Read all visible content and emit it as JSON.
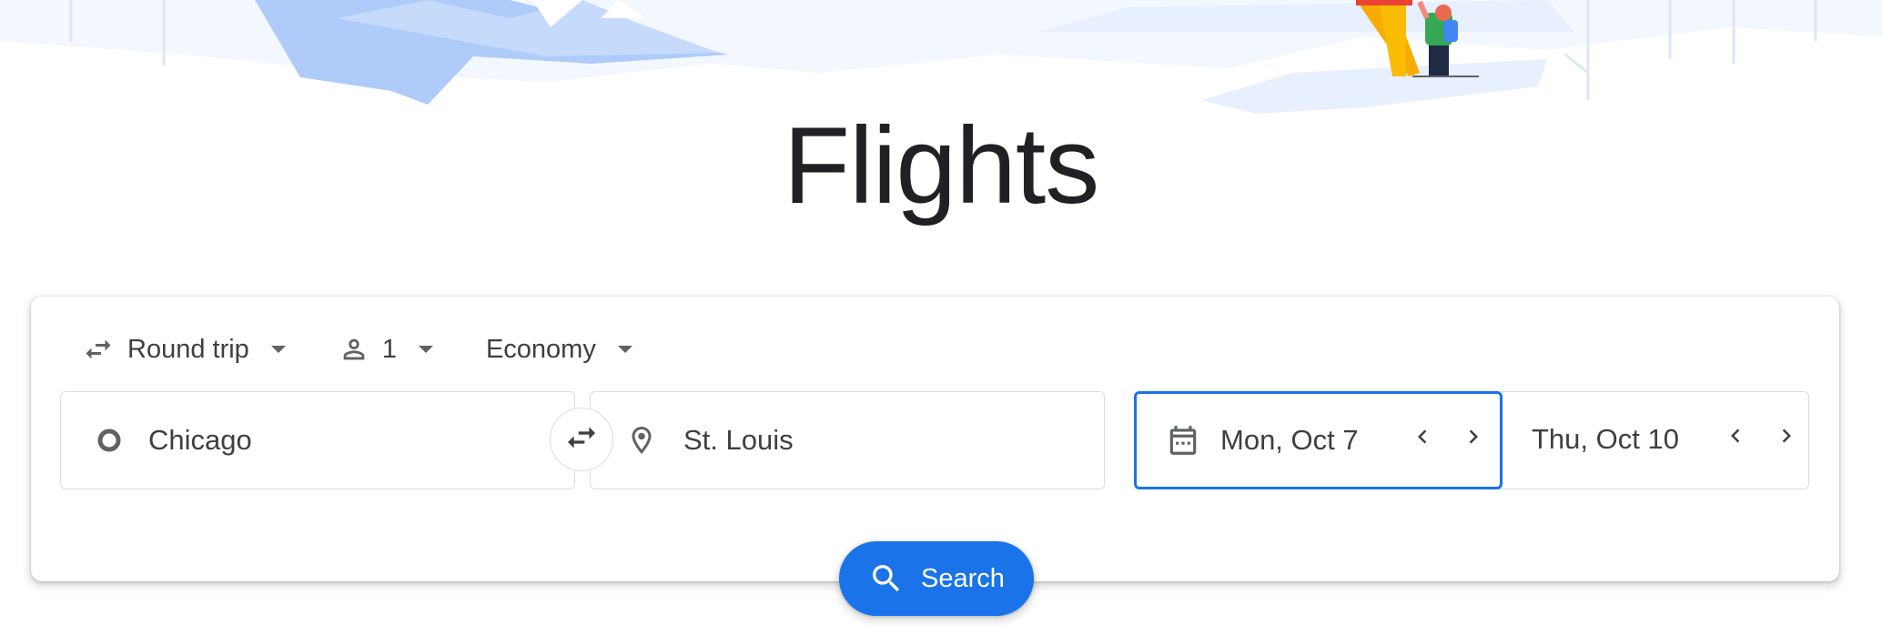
{
  "page": {
    "title": "Flights"
  },
  "options": {
    "trip_type": "Round trip",
    "passengers": "1",
    "cabin_class": "Economy"
  },
  "search": {
    "origin": "Chicago",
    "destination": "St. Louis",
    "departure_date": "Mon, Oct 7",
    "return_date": "Thu, Oct 10",
    "button_label": "Search"
  },
  "icons": {
    "trip_type": "swap-horizontal-icon",
    "passengers": "person-icon",
    "dropdown": "caret-down-icon",
    "origin": "circle-icon",
    "swap": "swap-arrows-icon",
    "destination": "location-pin-icon",
    "calendar": "calendar-icon",
    "previous": "chevron-left-icon",
    "next": "chevron-right-icon",
    "search": "search-icon"
  },
  "colors": {
    "accent": "#1a73e8",
    "illustration_light": "#e8f0fe",
    "illustration_mid": "#aecbfa",
    "text": "#3c4043",
    "title": "#202124"
  }
}
